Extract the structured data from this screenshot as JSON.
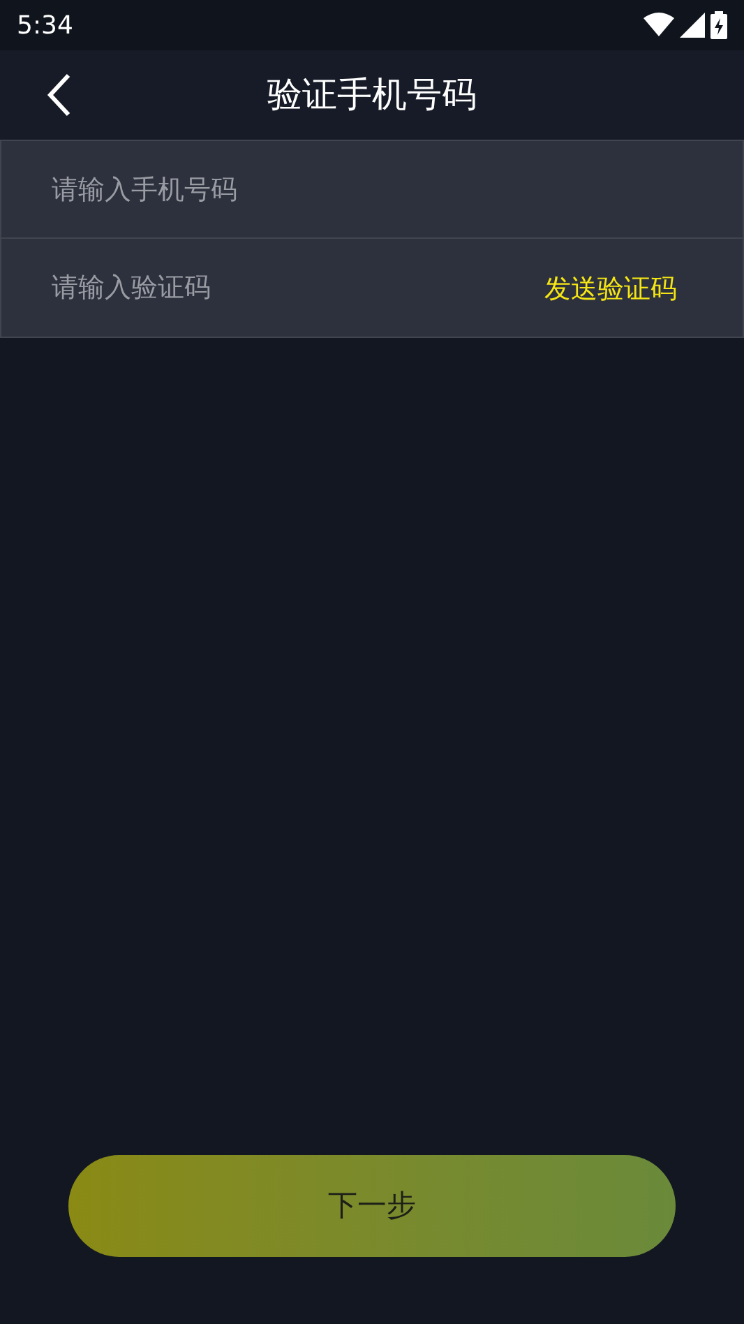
{
  "status_bar": {
    "time": "5:34"
  },
  "header": {
    "title": "验证手机号码"
  },
  "form": {
    "phone": {
      "placeholder": "请输入手机号码"
    },
    "code": {
      "placeholder": "请输入验证码",
      "send_button": "发送验证码"
    }
  },
  "next_button": "下一步"
}
